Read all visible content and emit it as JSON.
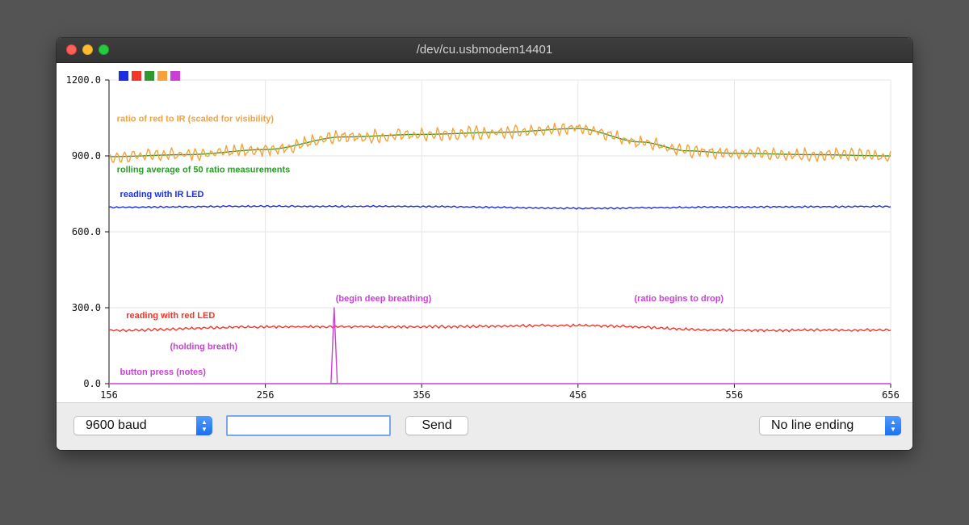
{
  "window": {
    "title": "/dev/cu.usbmodem14401"
  },
  "chart_data": {
    "type": "line",
    "xlim": [
      156,
      656
    ],
    "ylim": [
      0,
      1200
    ],
    "x_ticks": [
      156,
      256,
      356,
      456,
      556,
      656
    ],
    "x_tick_labels": [
      "156",
      "256",
      "356",
      "456",
      "556",
      "656"
    ],
    "y_ticks": [
      0,
      300,
      600,
      900,
      1200
    ],
    "y_tick_labels": [
      "0.0",
      "300.0",
      "600.0",
      "900.0",
      "1200.0"
    ],
    "grid": true,
    "legend_placement": "top-left",
    "legend_colors": [
      "#1a2fe0",
      "#f2362a",
      "#2e9a2e",
      "#f6a23a",
      "#cc3fd6"
    ],
    "series": [
      {
        "color": "#1a2fe0",
        "trend": {
          "x": [
            156,
            256,
            356,
            456,
            556,
            656
          ],
          "y": [
            697,
            701,
            700,
            693,
            698,
            700
          ]
        },
        "wiggle": 3,
        "period": 4
      },
      {
        "color": "#f2362a",
        "trend": {
          "x": [
            156,
            256,
            356,
            456,
            556,
            656
          ],
          "y": [
            210,
            225,
            225,
            230,
            211,
            212
          ]
        },
        "wiggle": 5,
        "period": 4
      },
      {
        "color": "#2e9a2e",
        "trend": {
          "x": [
            156,
            206,
            256,
            306,
            356,
            406,
            456,
            496,
            526,
            556,
            606,
            656
          ],
          "y": [
            897,
            905,
            925,
            975,
            985,
            993,
            1008,
            955,
            920,
            910,
            905,
            900
          ]
        },
        "wiggle": 0,
        "period": 4
      },
      {
        "color": "#f6a23a",
        "trend": {
          "x": [
            156,
            206,
            256,
            306,
            356,
            406,
            456,
            496,
            526,
            556,
            606,
            656
          ],
          "y": [
            897,
            905,
            925,
            975,
            985,
            993,
            1008,
            955,
            920,
            910,
            905,
            900
          ]
        },
        "wiggle": 25,
        "period": 5
      },
      {
        "color": "#cc3fd6",
        "points": [
          [
            156,
            0
          ],
          [
            298,
            0
          ],
          [
            300,
            300
          ],
          [
            302,
            0
          ],
          [
            656,
            0
          ]
        ]
      }
    ],
    "annotations": [
      {
        "text": "ratio of red to IR (scaled for visibility)",
        "x": 161,
        "y": 1035,
        "color": "#f6a23a"
      },
      {
        "text": "rolling average of 50 ratio measurements",
        "x": 161,
        "y": 835,
        "color": "#2e9a2e"
      },
      {
        "text": "reading with IR LED",
        "x": 163,
        "y": 738,
        "color": "#1a2fe0"
      },
      {
        "text": "reading with red LED",
        "x": 167,
        "y": 258,
        "color": "#f2362a"
      },
      {
        "text": "(holding breath)",
        "x": 195,
        "y": 135,
        "color": "#cc3fd6"
      },
      {
        "text": "button press (notes)",
        "x": 163,
        "y": 35,
        "color": "#cc3fd6"
      },
      {
        "text": "(begin deep breathing)",
        "x": 301,
        "y": 325,
        "color": "#cc3fd6"
      },
      {
        "text": "(ratio begins to drop)",
        "x": 492,
        "y": 325,
        "color": "#cc3fd6"
      }
    ]
  },
  "controls": {
    "baud_select": {
      "value": "9600 baud"
    },
    "message_input": {
      "value": "",
      "placeholder": ""
    },
    "send_label": "Send",
    "line_ending_select": {
      "value": "No line ending"
    }
  }
}
